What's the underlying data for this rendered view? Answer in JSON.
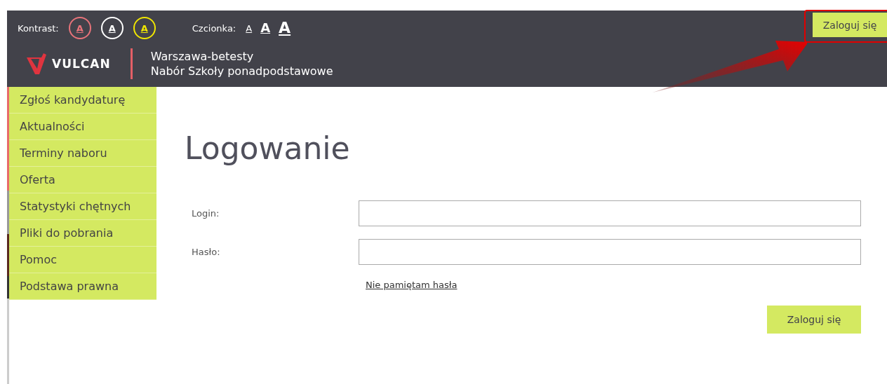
{
  "header": {
    "contrast_label": "Kontrast:",
    "contrast_options": [
      {
        "label": "A",
        "color": "#e8737a"
      },
      {
        "label": "A",
        "color": "#ffffff"
      },
      {
        "label": "A",
        "color": "#f0e600"
      }
    ],
    "font_label": "Czcionka:",
    "font_options": [
      {
        "label": "A",
        "kind": "small"
      },
      {
        "label": "A",
        "kind": "medium"
      },
      {
        "label": "A",
        "kind": "large"
      }
    ],
    "logo_text": "VULCAN",
    "site_lines": [
      "Warszawa-betesty",
      "Nabór Szkoły ponadpodstawowe"
    ],
    "login_button": "Zaloguj się"
  },
  "sidebar": {
    "items": [
      {
        "label": "Zgłoś kandydaturę"
      },
      {
        "label": "Aktualności"
      },
      {
        "label": "Terminy naboru"
      },
      {
        "label": "Oferta"
      },
      {
        "label": "Statystyki chętnych"
      },
      {
        "label": "Pliki do pobrania"
      },
      {
        "label": "Pomoc"
      },
      {
        "label": "Podstawa prawna"
      }
    ]
  },
  "login": {
    "title": "Logowanie",
    "fields": [
      {
        "label": "Login:"
      },
      {
        "label": "Hasło:"
      }
    ],
    "forgot_link": "Nie pamiętam hasła",
    "submit": "Zaloguj się"
  }
}
